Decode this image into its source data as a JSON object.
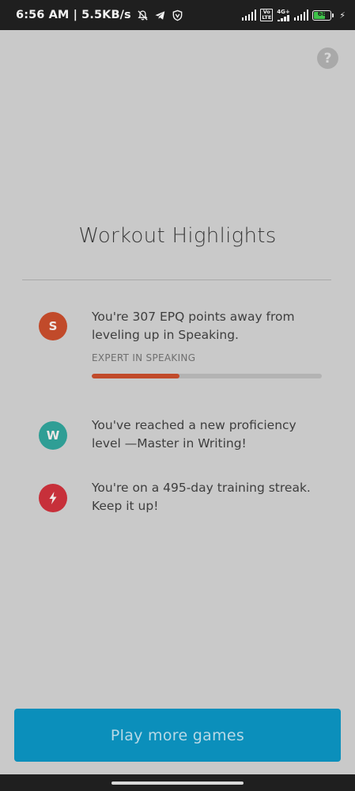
{
  "status_bar": {
    "time_speed": "6:56 AM | 5.5KB/s",
    "volte_label": "Vo\nLTE",
    "net_label": "4G+",
    "battery_level": "68",
    "icons": [
      "mute-icon",
      "telegram-icon",
      "vpn-shield-icon",
      "signal-icon",
      "signal-icon",
      "battery-icon",
      "charging-icon"
    ]
  },
  "help": {
    "icon": "?"
  },
  "title": "Workout Highlights",
  "highlights": [
    {
      "badge": "S",
      "color": "#c14a2a",
      "text": "You're 307 EPQ points away from leveling up in Speaking.",
      "sub": "EXPERT IN SPEAKING",
      "progress": 0.38
    },
    {
      "badge": "W",
      "color": "#2f9e95",
      "text": "You've reached a new proficiency level —Master in Writing!"
    },
    {
      "badge": "bolt",
      "color": "#c7303a",
      "text": "You're on a 495-day training streak. Keep it up!"
    }
  ],
  "cta": {
    "label": "Play more games"
  }
}
